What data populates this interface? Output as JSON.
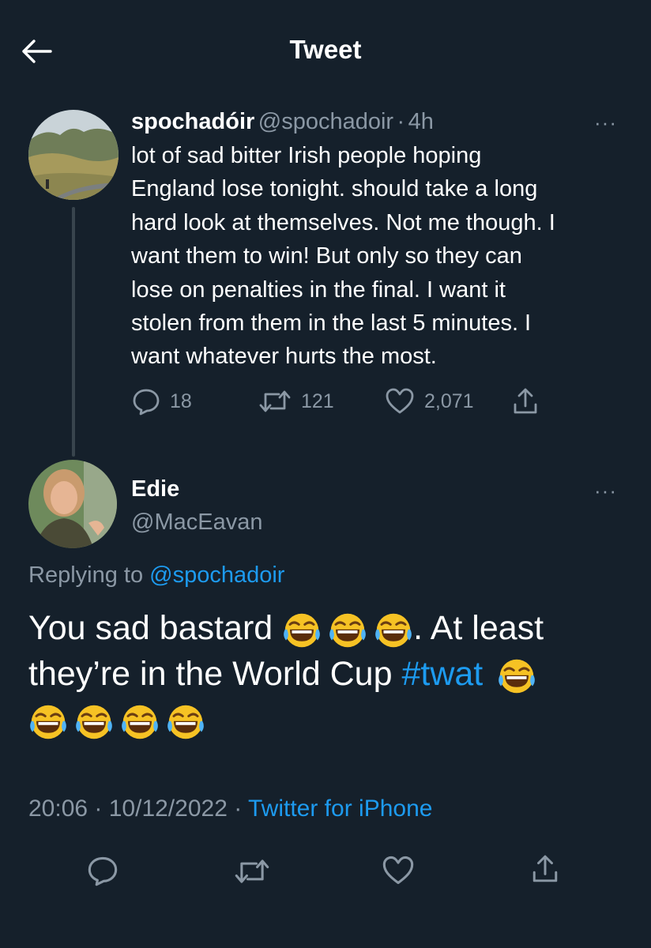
{
  "header": {
    "title": "Tweet"
  },
  "original_tweet": {
    "display_name": "spochadóir",
    "handle": "@spochadoir",
    "separator": "·",
    "time": "4h",
    "more": "···",
    "lines": [
      "lot of sad bitter Irish people hoping",
      "England lose tonight. should take a long",
      "hard look at themselves. Not me though. I",
      "want them to win! But only so they can",
      "lose on penalties in the final. I want it",
      "stolen from them in the last 5 minutes. I",
      "want whatever hurts the most."
    ],
    "reply_count": "18",
    "retweet_count": "121",
    "like_count": "2,071"
  },
  "reply_tweet": {
    "display_name": "Edie",
    "handle": "@MacEavan",
    "more": "···",
    "replying_prefix": "Replying to ",
    "replying_handle": "@spochadoir",
    "text_part1": "You sad bastard",
    "text_part2": ". At least",
    "text_part3": "they’re in the World Cup",
    "hashtag": "#twat",
    "emoji_name": "face-with-tears-of-joy",
    "timestamp": "20:06 · 10/12/2022 · ",
    "source": "Twitter for iPhone"
  },
  "colors": {
    "background": "#15202b",
    "text": "#ffffff",
    "muted": "#8b98a5",
    "link": "#1d9bf0",
    "thread_line": "#38444d"
  }
}
